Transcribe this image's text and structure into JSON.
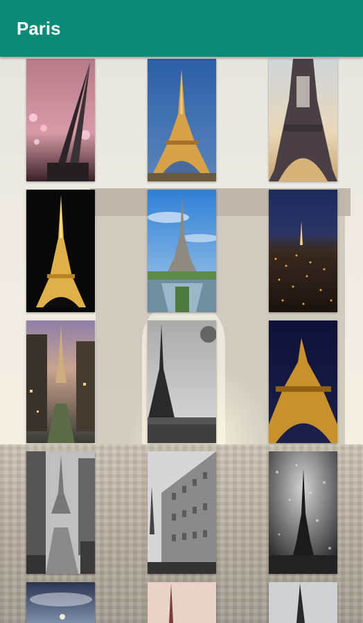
{
  "header": {
    "title": "Paris"
  },
  "gallery": {
    "items": [
      {
        "subject": "eiffel-tower-pink-bokeh"
      },
      {
        "subject": "eiffel-tower-golden-blue-sky"
      },
      {
        "subject": "eiffel-tower-base-sunset"
      },
      {
        "subject": "eiffel-tower-night-lit"
      },
      {
        "subject": "eiffel-tower-trocadero-gardens"
      },
      {
        "subject": "paris-city-lights-night"
      },
      {
        "subject": "paris-street-tower-dusk"
      },
      {
        "subject": "eiffel-tower-black-white"
      },
      {
        "subject": "eiffel-tower-golden-closeup"
      },
      {
        "subject": "paris-street-black-white"
      },
      {
        "subject": "paris-buildings-tower-black-white"
      },
      {
        "subject": "eiffel-tower-rain-window"
      },
      {
        "subject": "paris-skyline-clouds"
      },
      {
        "subject": "eiffel-tower-pink-sky"
      },
      {
        "subject": "eiffel-tower-grey-sky"
      }
    ]
  },
  "colors": {
    "app_bar": "#0b8a77",
    "title_text": "#ffffff"
  }
}
